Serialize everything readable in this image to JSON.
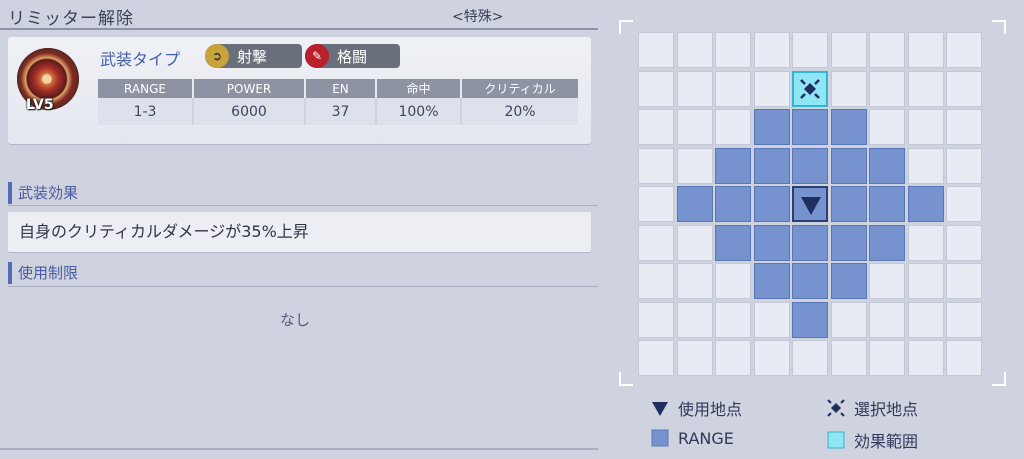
{
  "header": {
    "title": "リミッター解除",
    "category": "<特殊>"
  },
  "weapon": {
    "level": "LV5",
    "type_label": "武装タイプ",
    "tags": [
      {
        "label": "射撃",
        "icon": "shoot-icon",
        "color": "#c8a33c"
      },
      {
        "label": "格闘",
        "icon": "melee-icon",
        "color": "#b8202c"
      }
    ],
    "stats": {
      "headers": [
        "RANGE",
        "POWER",
        "EN",
        "命中",
        "クリティカル"
      ],
      "values": [
        "1-3",
        "6000",
        "37",
        "100%",
        "20%"
      ]
    }
  },
  "effect": {
    "heading": "武装効果",
    "text": "自身のクリティカルダメージが35%上昇"
  },
  "limit": {
    "heading": "使用制限",
    "text": "なし"
  },
  "range_grid": {
    "rows": 9,
    "cols": 9,
    "range_cells": [
      [
        2,
        3
      ],
      [
        2,
        4
      ],
      [
        2,
        5
      ],
      [
        3,
        2
      ],
      [
        3,
        3
      ],
      [
        3,
        4
      ],
      [
        3,
        5
      ],
      [
        3,
        6
      ],
      [
        4,
        1
      ],
      [
        4,
        2
      ],
      [
        4,
        3
      ],
      [
        4,
        5
      ],
      [
        4,
        6
      ],
      [
        4,
        7
      ],
      [
        5,
        2
      ],
      [
        5,
        3
      ],
      [
        5,
        4
      ],
      [
        5,
        5
      ],
      [
        5,
        6
      ],
      [
        6,
        3
      ],
      [
        6,
        4
      ],
      [
        6,
        5
      ],
      [
        7,
        4
      ]
    ],
    "origin_cell": [
      4,
      4
    ],
    "target_cell": [
      1,
      4
    ]
  },
  "legend": {
    "origin": "使用地点",
    "target": "選択地点",
    "range": "RANGE",
    "effect_area": "効果範囲"
  },
  "colors": {
    "range": "#7693cf",
    "origin_marker": "#1e2f5e",
    "effect_area": "#8ee6f4",
    "accent": "#5369b5"
  }
}
